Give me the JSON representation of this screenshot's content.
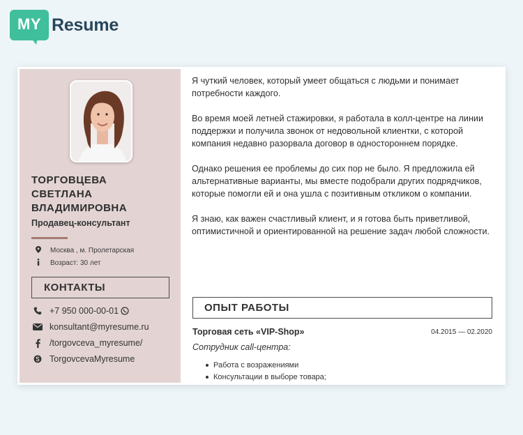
{
  "logo": {
    "my": "MY",
    "resume": "Resume"
  },
  "profile": {
    "name_lines": [
      "Торговцева",
      "Светлана",
      "Владимировна"
    ],
    "position": "Продавец-консультант",
    "location": "Москва , м. Пролетарская",
    "age": "Возраст: 30 лет"
  },
  "contacts": {
    "heading": "КОНТАКТЫ",
    "phone": "+7 950 000-00-01",
    "email": "konsultant@myresume.ru",
    "facebook": "/torgovceva_myresume/",
    "skype": "TorgovcevaMyresume"
  },
  "about": [
    "Я чуткий человек, который умеет общаться с людьми и понимает потребности каждого.",
    "Во время моей летней стажировки, я работала в колл-центре на линии поддержки и получила звонок от недовольной клиентки, с которой компания недавно разорвала договор в одностороннем порядке.",
    "Однако решения ее проблемы до сих пор не было. Я предложила ей альтернативные варианты, мы вместе подобрали других подрядчиков, которые помогли ей и она ушла с позитивным откликом о компании.",
    "Я знаю, как важен счастливый клиент, и я готова быть приветливой, оптимистичной и ориентированной на решение задач любой сложности."
  ],
  "experience": {
    "heading": "ОПЫТ РАБОТЫ",
    "company": "Торговая сеть «VIP-Shop»",
    "dates": "04.2015 — 02.2020",
    "role": "Сотрудник call-центра:",
    "duties": [
      "Работа с возражениями",
      "Консультации в выборе товара;"
    ]
  },
  "colors": {
    "sidebar": "#e3d4d3",
    "accent": "#a47b72",
    "logo_green": "#3fbf9b",
    "logo_text": "#28465b",
    "background": "#eef5f8"
  }
}
